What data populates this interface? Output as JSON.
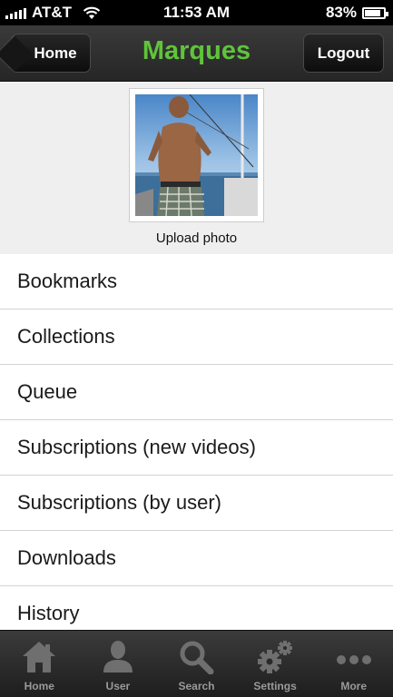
{
  "status": {
    "carrier": "AT&T",
    "time": "11:53 AM",
    "battery": "83%",
    "battery_level": 0.83
  },
  "nav": {
    "back_label": "Home",
    "title": "Marques",
    "logout_label": "Logout"
  },
  "profile": {
    "upload_label": "Upload photo"
  },
  "menu": {
    "items": [
      "Bookmarks",
      "Collections",
      "Queue",
      "Subscriptions (new videos)",
      "Subscriptions (by user)",
      "Downloads",
      "History"
    ]
  },
  "tabs": {
    "items": [
      {
        "label": "Home",
        "icon": "home-icon"
      },
      {
        "label": "User",
        "icon": "user-icon"
      },
      {
        "label": "Search",
        "icon": "search-icon"
      },
      {
        "label": "Settings",
        "icon": "gear-icon"
      },
      {
        "label": "More",
        "icon": "more-icon"
      }
    ]
  },
  "colors": {
    "title_green": "#5fc43a",
    "tab_icon": "#6f6f6f"
  }
}
